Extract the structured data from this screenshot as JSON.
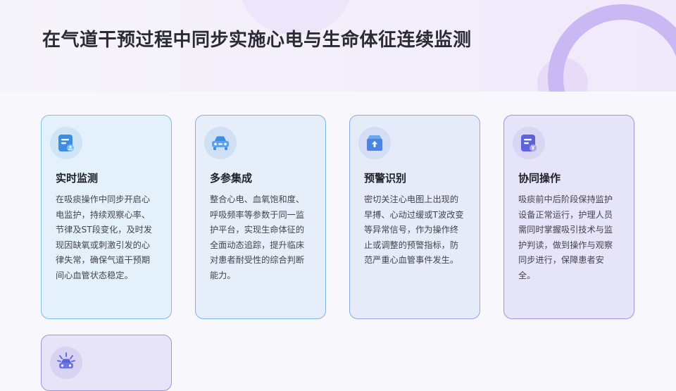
{
  "header": {
    "title": "在气道干预过程中同步实施心电与生命体征连续监测"
  },
  "cards": [
    {
      "icon": "monitor-report-icon",
      "title": "实时监测",
      "text": "在吸痰操作中同步开启心电监护，持续观察心率、节律及ST段变化，及时发现因缺氧或刺激引发的心律失常，确保气道干预期间心血管状态稳定。"
    },
    {
      "icon": "car-icon",
      "title": "多参集成",
      "text": "整合心电、血氧饱和度、呼吸频率等参数于同一监护平台，实现生命体征的全面动态追踪，提升临床对患者耐受性的综合判断能力。"
    },
    {
      "icon": "upload-box-icon",
      "title": "预警识别",
      "text": "密切关注心电图上出现的早搏、心动过缓或T波改变等异常信号，作为操作终止或调整的预警指标，防范严重心血管事件发生。"
    },
    {
      "icon": "document-yen-icon",
      "title": "协同操作",
      "text": "吸痰前中后阶段保持监护设备正常运行，护理人员需同时掌握吸引技术与监护判读，做到操作与观察同步进行，保障患者安全。"
    },
    {
      "icon": "car-alert-icon",
      "title": "",
      "text": ""
    }
  ],
  "colors": {
    "icon_primary": "#4a7fe0",
    "icon_secondary": "#8f86e6",
    "deco_ring": "#c9b8f4"
  }
}
